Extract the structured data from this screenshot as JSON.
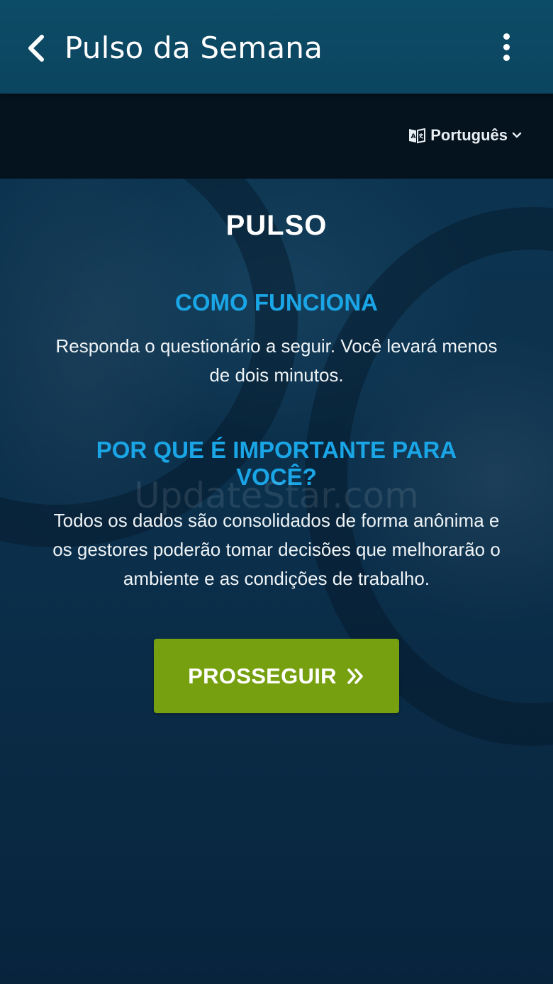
{
  "app_bar": {
    "title": "Pulso da Semana",
    "back_icon": "chevron-left-icon",
    "menu_icon": "more-vert-icon"
  },
  "language": {
    "selected": "Português",
    "icon": "book-translate-icon",
    "dropdown_icon": "chevron-down-icon"
  },
  "page": {
    "title": "PULSO",
    "how_it_works": {
      "heading": "COMO FUNCIONA",
      "body": "Responda o questionário a seguir. Você levará menos de dois minutos."
    },
    "why_important": {
      "heading": "POR QUE É IMPORTANTE PARA VOCÊ?",
      "body": "Todos os dados são consolidados de forma anônima e os gestores poderão tomar decisões que melhorarão o ambiente e as condições de trabalho."
    },
    "proceed_button": {
      "label": "PROSSEGUIR",
      "icon": "double-chevron-right-icon"
    }
  },
  "watermark": "UpdateStar.com",
  "colors": {
    "app_bar": "#0d4c66",
    "language_bar": "#05131f",
    "heading_accent": "#1aa6e6",
    "button": "#76a00f"
  }
}
